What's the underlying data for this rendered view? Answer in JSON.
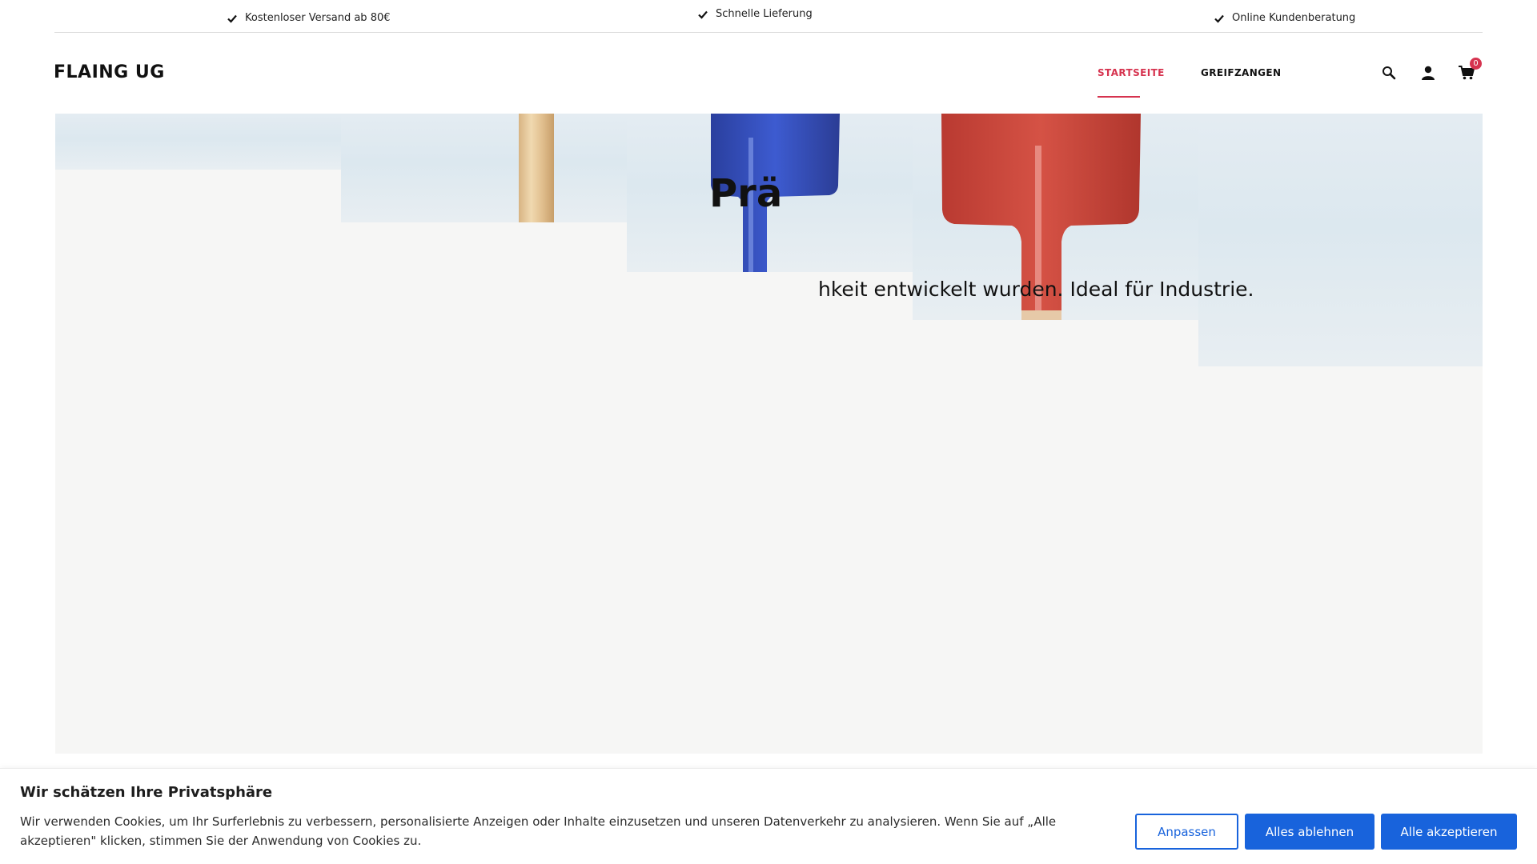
{
  "topbar": {
    "usps": [
      {
        "icon": "check-icon",
        "label": "Kostenloser Versand ab 80€"
      },
      {
        "icon": "check-icon",
        "label": "Schnelle Lieferung"
      },
      {
        "icon": "check-icon",
        "label": "Online Kundenberatung"
      }
    ]
  },
  "header": {
    "logo": "FLAING UG",
    "nav": [
      {
        "label": "STARTSEITE",
        "active": true
      },
      {
        "label": "GREIFZANGEN",
        "active": false
      }
    ],
    "icons": [
      "search-icon",
      "account-icon",
      "cart-icon"
    ],
    "cart_count": "0",
    "accent_color": "#d6334f"
  },
  "hero": {
    "title": "Prä",
    "subtitle": "hkeit entwickelt wurden. Ideal für Industrie."
  },
  "cookie_banner": {
    "title": "Wir schätzen Ihre Privatsphäre",
    "text": "Wir verwenden Cookies, um Ihr Surferlebnis zu verbessern, personalisierte Anzeigen oder Inhalte einzusetzen und unseren Datenverkehr zu analysieren. Wenn Sie auf „Alle akzeptieren\" klicken, stimmen Sie der Anwendung von Cookies zu.",
    "buttons": {
      "customize": "Anpassen",
      "reject": "Alles ablehnen",
      "accept": "Alle akzeptieren"
    },
    "button_color": "#1863dc"
  }
}
